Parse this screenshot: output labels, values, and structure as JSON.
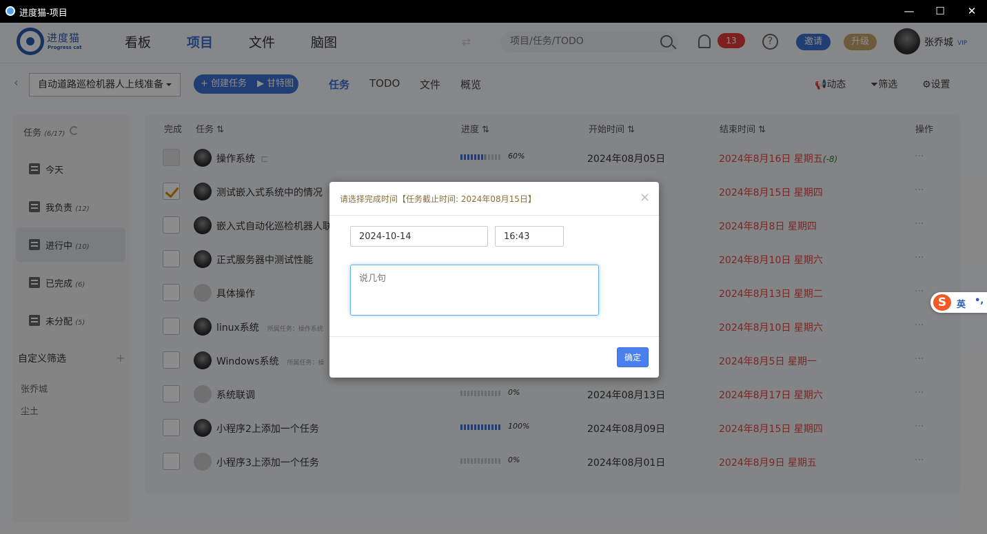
{
  "window": {
    "title": "进度猫-项目",
    "minimize": "—",
    "maximize": "☐",
    "close": "✕"
  },
  "logo": {
    "cn": "进度猫",
    "en": "Progress cat"
  },
  "topnav": {
    "items": [
      "看板",
      "项目",
      "文件",
      "脑图"
    ],
    "active": "项目",
    "search_placeholder": "项目/任务/TODO",
    "notifications": "13",
    "help": "?",
    "invite": "邀请",
    "upgrade": "升级",
    "user": "张乔城",
    "vip": "VIP"
  },
  "subbar": {
    "project": "自动道路巡检机器人上线准备",
    "create_task": "+ 创建任务",
    "gantt": "▶ 甘特图",
    "tabs": [
      "任务",
      "TODO",
      "文件",
      "概览"
    ],
    "active_tab": "任务",
    "activity": "动态",
    "filter": "筛选",
    "settings": "设置"
  },
  "sidebar": {
    "header": "任务",
    "header_count": "(6/17)",
    "items": [
      {
        "label": "今天",
        "count": ""
      },
      {
        "label": "我负责",
        "count": "(12)"
      },
      {
        "label": "进行中",
        "count": "(10)"
      },
      {
        "label": "已完成",
        "count": "(6)"
      },
      {
        "label": "未分配",
        "count": "(5)"
      }
    ],
    "active_index": 2,
    "custom_filter": "自定义筛选",
    "members": [
      "张乔城",
      "尘土"
    ]
  },
  "table": {
    "headers": {
      "done": "完成",
      "task": "任务 ⇅",
      "progress": "进度 ⇅",
      "start": "开始时间 ⇅",
      "end": "结束时间 ⇅",
      "ops": "操作"
    },
    "rows": [
      {
        "name": "操作系统",
        "parent": "",
        "progress": 0.6,
        "pct": "60%",
        "start": "2024年08月05日",
        "end": "2024年8月16日 星期五",
        "overdue": "(-8)",
        "checked": false,
        "avatar": "dark",
        "ops": "···"
      },
      {
        "name": "测试嵌入式系统中的情况",
        "parent": "",
        "progress": 0,
        "pct": "",
        "start": "",
        "end": "2024年8月15日 星期四",
        "overdue": "",
        "checked": true,
        "avatar": "dark",
        "ops": "···"
      },
      {
        "name": "嵌入式自动化巡检机器人联",
        "parent": "",
        "progress": 0,
        "pct": "",
        "start": "",
        "end": "2024年8月8日 星期四",
        "overdue": "",
        "checked": false,
        "avatar": "dark",
        "ops": "···"
      },
      {
        "name": "正式服务器中测试性能",
        "parent": "",
        "progress": 0,
        "pct": "",
        "start": "",
        "end": "2024年8月10日 星期六",
        "overdue": "",
        "checked": false,
        "avatar": "dark",
        "ops": "···"
      },
      {
        "name": "具体操作",
        "parent": "",
        "progress": 0,
        "pct": "",
        "start": "",
        "end": "2024年8月13日 星期二",
        "overdue": "",
        "checked": false,
        "avatar": "grey",
        "ops": "···"
      },
      {
        "name": "linux系统",
        "parent": "所属任务：操作系统",
        "progress": 0,
        "pct": "",
        "start": "",
        "end": "2024年8月10日 星期六",
        "overdue": "",
        "checked": false,
        "avatar": "dark",
        "ops": "···"
      },
      {
        "name": "Windows系统",
        "parent": "所属任务：操",
        "progress": 0,
        "pct": "",
        "start": "",
        "end": "2024年8月5日 星期一",
        "overdue": "",
        "checked": false,
        "avatar": "dark",
        "ops": "···"
      },
      {
        "name": "系统联调",
        "parent": "",
        "progress": 0,
        "pct": "0%",
        "start": "2024年08月13日",
        "end": "2024年8月17日 星期六",
        "overdue": "",
        "checked": false,
        "avatar": "grey",
        "ops": "···"
      },
      {
        "name": "小程序2上添加一个任务",
        "parent": "",
        "progress": 1.0,
        "pct": "100%",
        "start": "2024年08月09日",
        "end": "2024年8月15日 星期四",
        "overdue": "",
        "checked": false,
        "avatar": "dark",
        "ops": "···"
      },
      {
        "name": "小程序3上添加一个任务",
        "parent": "",
        "progress": 0,
        "pct": "0%",
        "start": "2024年08月01日",
        "end": "2024年8月9日 星期五",
        "overdue": "",
        "checked": false,
        "avatar": "grey",
        "ops": "···"
      }
    ]
  },
  "modal": {
    "title": "请选择完成时间【任务截止时间: 2024年08月15日】",
    "close": "×",
    "date": "2024-10-14",
    "time": "16:43",
    "comment_placeholder": "说几句",
    "confirm": "确定"
  },
  "ime": {
    "logo": "S",
    "mode": "英",
    "punct": "•,"
  }
}
